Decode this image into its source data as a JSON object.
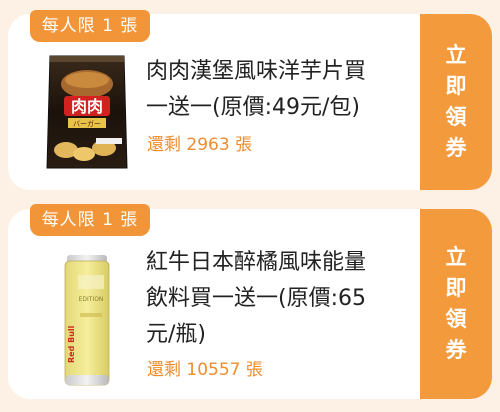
{
  "coupons": [
    {
      "limit": "每人限 1 張",
      "title": "肉肉漢堡風味洋芋片買\n一送一(原價:49元/包)",
      "remaining": "還剩 2963 張",
      "product_image_text": "肉肉 バーガー",
      "claim_chars": [
        "立",
        "即",
        "領",
        "券"
      ]
    },
    {
      "limit": "每人限 1 張",
      "title": "紅牛日本醉橘風味能量\n飲料買一送一(原價:65\n元/瓶)",
      "remaining": "還剩 10557 張",
      "product_image_text": "Red Bull",
      "claim_chars": [
        "立",
        "即",
        "領",
        "券"
      ]
    }
  ],
  "colors": {
    "accent": "#f39a3d",
    "remaining_text": "#ef8c2e",
    "background": "#fdf1e6"
  }
}
